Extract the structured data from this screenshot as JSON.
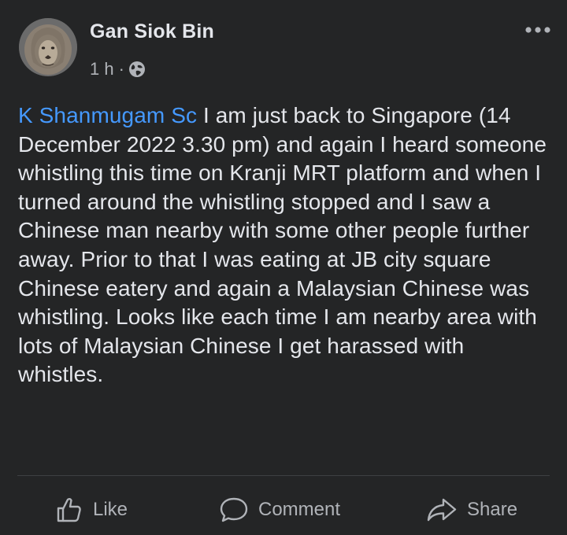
{
  "post": {
    "author": "Gan Siok Bin",
    "time": "1 h",
    "separator": "·",
    "privacy_icon": "globe-icon",
    "more_icon": "more-options-icon",
    "mention": "K Shanmugam Sc",
    "text": " I am just back to Singapore (14 December 2022 3.30 pm) and again I heard someone whistling this time on Kranji MRT platform and when I turned around the whistling stopped and I saw a Chinese man nearby with some other people further away. Prior to that I was eating at JB city square Chinese eatery and again a Malaysian Chinese was whistling. Looks like each time I am nearby area with lots of Malaysian Chinese I get harassed with whistles."
  },
  "actions": {
    "like": "Like",
    "comment": "Comment",
    "share": "Share"
  },
  "colors": {
    "background": "#242526",
    "text": "#e4e6eb",
    "secondary": "#b0b3b8",
    "mention": "#4599ff"
  }
}
